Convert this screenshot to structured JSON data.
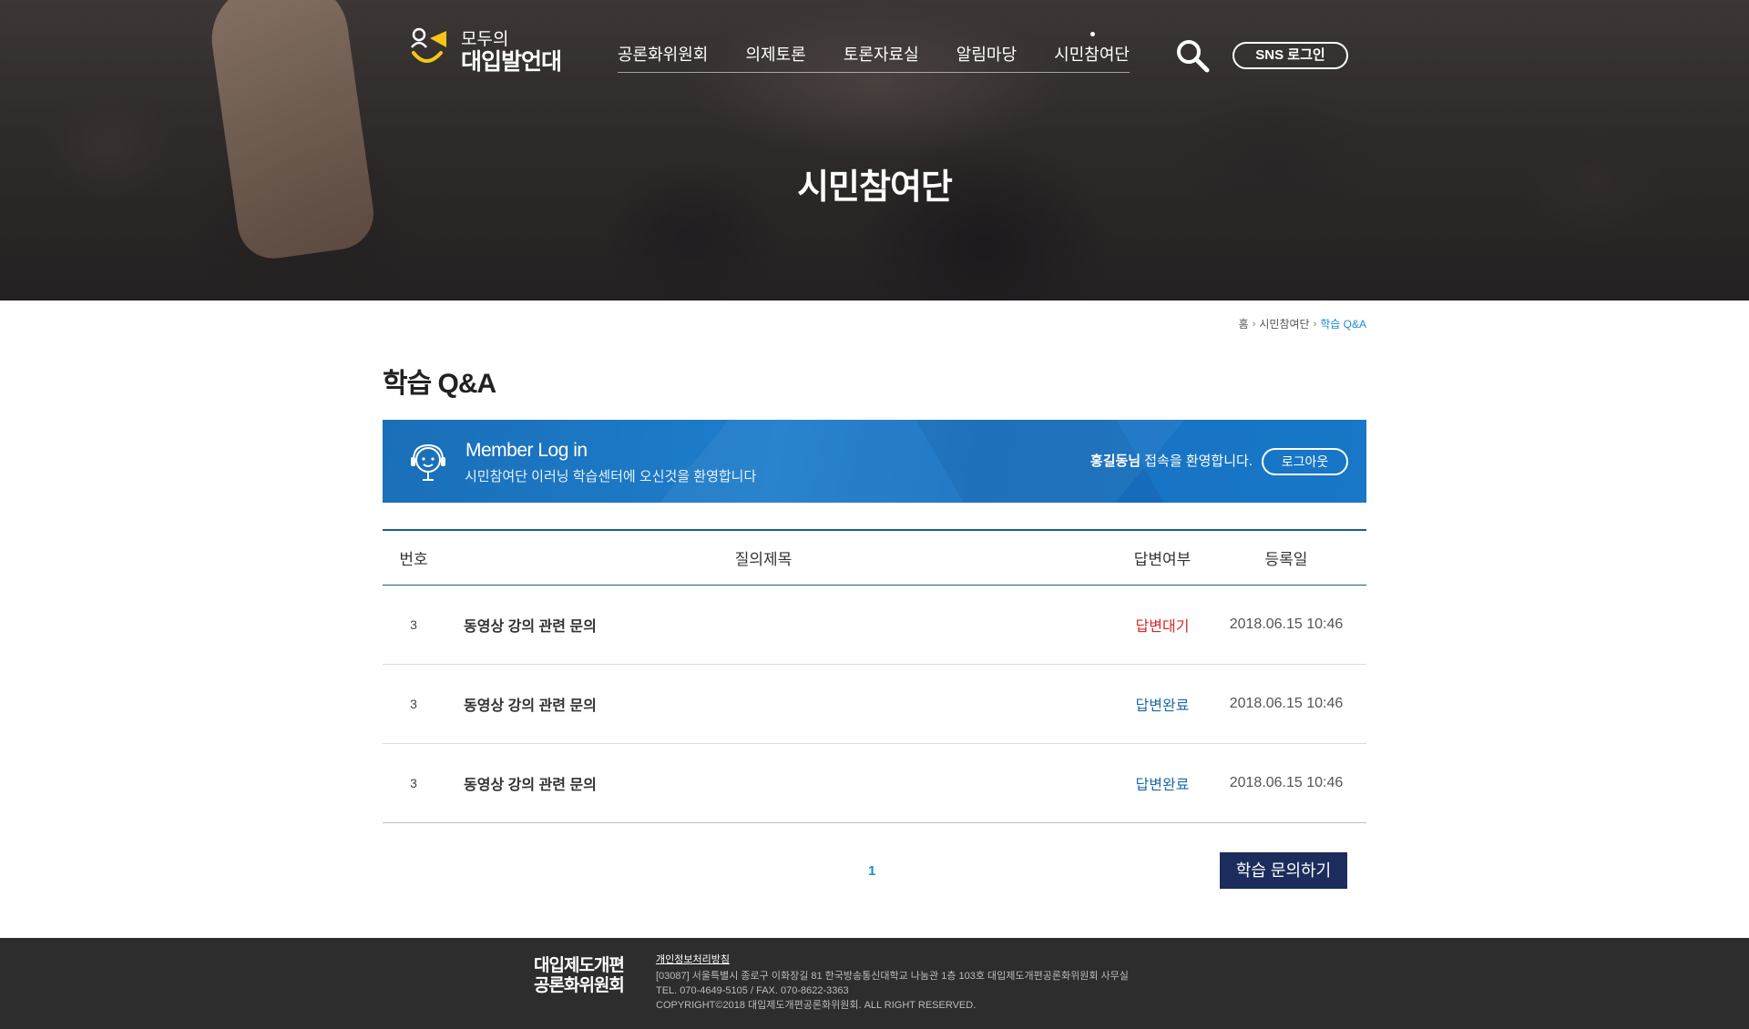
{
  "header": {
    "logo_small": "모두의",
    "logo_big": "대입발언대",
    "menu": [
      {
        "label": "공론화위원회"
      },
      {
        "label": "의제토론"
      },
      {
        "label": "토론자료실"
      },
      {
        "label": "알림마당"
      },
      {
        "label": "시민참여단"
      }
    ],
    "active_menu": "시민참여단",
    "sns_login": "SNS 로그인",
    "hero_title": "시민참여단"
  },
  "breadcrumb": {
    "home": "홈",
    "parent": "시민참여단",
    "current": "학습 Q&A"
  },
  "page_title": "학습 Q&A",
  "member": {
    "title": "Member Log in",
    "subtitle": "시민참여단 이러닝 학습센터에 오신것을 환영합니다",
    "user_name": "홍길동님",
    "welcome_text": " 접속을 환영합니다.",
    "logout": "로그아웃"
  },
  "board": {
    "columns": {
      "no": "번호",
      "title": "질의제목",
      "status": "답변여부",
      "date": "등록일"
    },
    "rows": [
      {
        "no": "3",
        "title": "동영상 강의 관련 문의",
        "status": "답변대기",
        "date": "2018.06.15  10:46"
      },
      {
        "no": "3",
        "title": "동영상 강의 관련 문의",
        "status": "답변완료",
        "date": "2018.06.15  10:46"
      },
      {
        "no": "3",
        "title": "동영상 강의 관련 문의",
        "status": "답변완료",
        "date": "2018.06.15  10:46"
      }
    ]
  },
  "pagination": {
    "current": "1"
  },
  "ask_button": "학습 문의하기",
  "footer": {
    "logo_line1": "대입제도개편",
    "logo_line2": "공론화위원회",
    "policy": "개인정보처리방침",
    "address": "[03087] 서울특별시 종로구 이화장길 81 한국방송통신대학교 나눔관 1층 103호 대입제도개편공론화위원회 사무실",
    "tel": "TEL. 070-4649-5105 / FAX. 070-8622-3363",
    "copyright": "COPYRIGHT©2018 대입제도개편공론화위원회. ALL RIGHT RESERVED."
  },
  "colors": {
    "accent_blue": "#1a8bd6",
    "banner_blue": "#1e7dcb",
    "status_wait": "#d62828",
    "status_done": "#1a6aa8",
    "button_navy": "#1c2c5c",
    "footer_bg": "#2d2d2d"
  }
}
